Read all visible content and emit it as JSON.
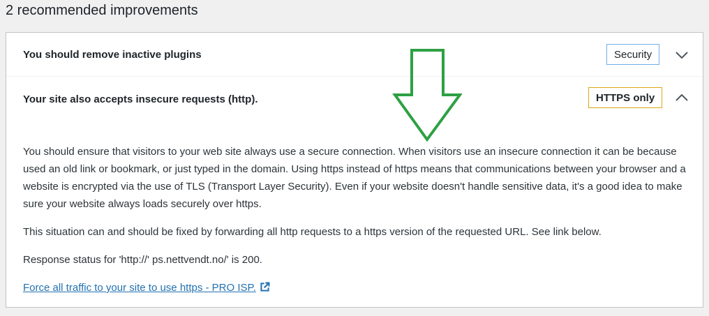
{
  "heading": "2 recommended improvements",
  "items": [
    {
      "title": "You should remove inactive plugins",
      "badge": "Security",
      "expanded": false
    },
    {
      "title": "Your site also accepts insecure requests (http).",
      "badge": "HTTPS only",
      "expanded": true,
      "paragraphs": [
        "You should ensure that visitors to your web site always use a secure connection. When visitors use an insecure connection it can be because used an old link or bookmark, or just typed in the domain. Using https instead of https means that communications between your browser and a website is encrypted via the use of TLS (Transport Layer Security). Even if your website doesn't handle sensitive data, it's a good idea to make sure your website always loads securely over https.",
        "This situation can and should be fixed by forwarding all http requests to a https version of the requested URL. See link below.",
        "Response status for 'http://'     ps.nettvendt.no/' is 200."
      ],
      "link_text": "Force all traffic to your site to use https - PRO ISP."
    }
  ],
  "colors": {
    "security_badge_border": "#72aee6",
    "https_badge_border": "#dba617",
    "link": "#2271b1",
    "annotation_arrow": "#2ea043"
  },
  "icons": {
    "collapsed": "chevron-down-icon",
    "expanded": "chevron-up-icon",
    "external": "external-link-icon"
  }
}
